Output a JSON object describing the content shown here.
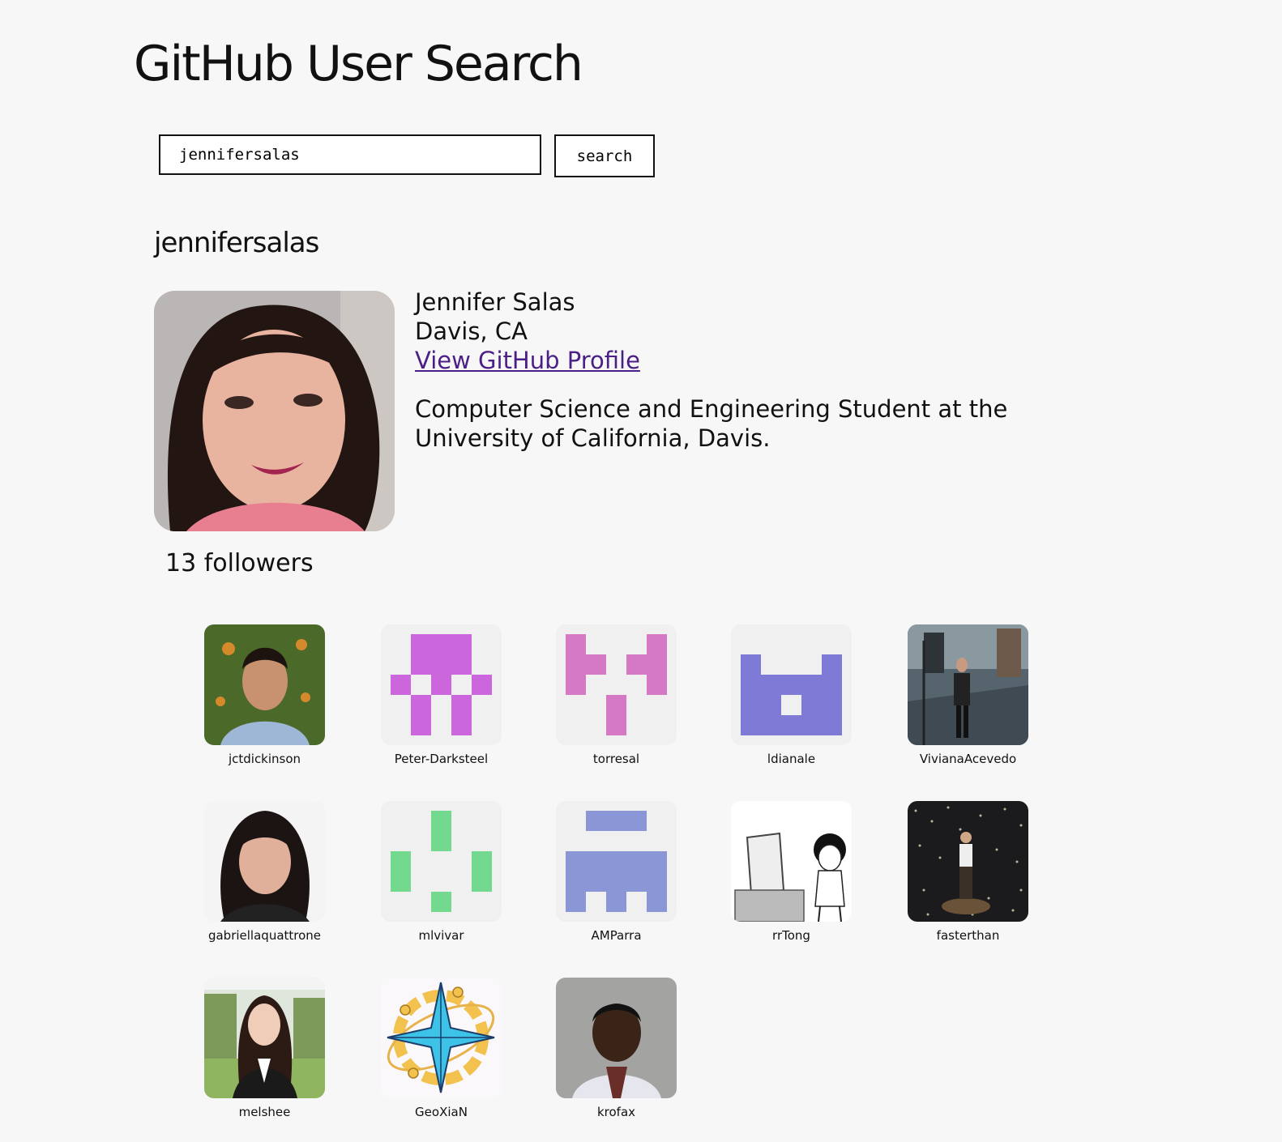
{
  "app": {
    "title": "GitHub User Search"
  },
  "search": {
    "value": "jennifersalas",
    "button_label": "search"
  },
  "profile": {
    "username": "jennifersalas",
    "name": "Jennifer Salas",
    "location": "Davis, CA",
    "link_label": "View GitHub Profile",
    "bio": "Computer Science and Engineering Student at the University of California, Davis.",
    "followers_label": "13 followers"
  },
  "followers": [
    {
      "login": "jctdickinson",
      "avatar": "photo-man-icon"
    },
    {
      "login": "Peter-Darksteel",
      "avatar": "identicon-magenta"
    },
    {
      "login": "torresal",
      "avatar": "identicon-pink"
    },
    {
      "login": "ldianale",
      "avatar": "identicon-purple"
    },
    {
      "login": "VivianaAcevedo",
      "avatar": "photo-street-icon"
    },
    {
      "login": "gabriellaquattrone",
      "avatar": "photo-woman-icon"
    },
    {
      "login": "mlvivar",
      "avatar": "identicon-green"
    },
    {
      "login": "AMParra",
      "avatar": "identicon-blue"
    },
    {
      "login": "rrTong",
      "avatar": "cartoon-computer-icon"
    },
    {
      "login": "fasterthan",
      "avatar": "photo-lights-icon"
    },
    {
      "login": "melshee",
      "avatar": "photo-woman-park-icon"
    },
    {
      "login": "GeoXiaN",
      "avatar": "compass-star-icon"
    },
    {
      "login": "krofax",
      "avatar": "photo-man-wall-icon"
    }
  ],
  "colors": {
    "background": "#f7f7f7",
    "link": "#4b1f86",
    "identicon_magenta": "#cc66dd",
    "identicon_pink": "#d679c4",
    "identicon_purple": "#7f7ad6",
    "identicon_green": "#72d98e",
    "identicon_blue": "#8b96d6"
  }
}
